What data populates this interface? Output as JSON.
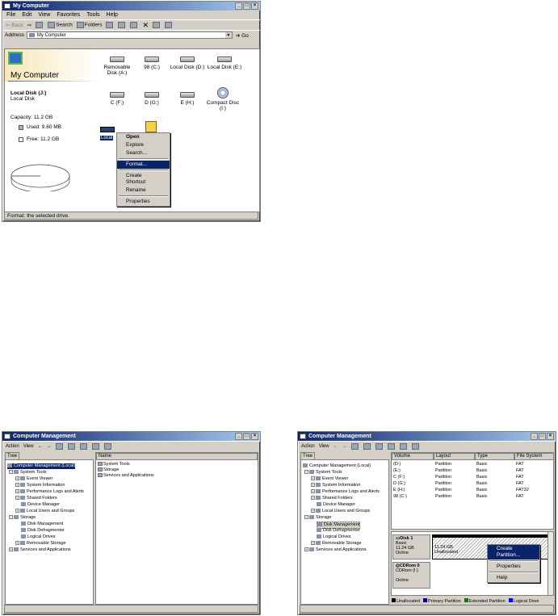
{
  "mycomputer": {
    "title": "My Computer",
    "menu": [
      "File",
      "Edit",
      "View",
      "Favorites",
      "Tools",
      "Help"
    ],
    "toolbar": {
      "back": "Back",
      "search": "Search",
      "folders": "Folders"
    },
    "address": {
      "label": "Address",
      "value": "My Computer",
      "go": "Go"
    },
    "heading": "My Computer",
    "selected": {
      "name": "Local Disk (J:)",
      "type": "Local Disk",
      "capacity": "Capacity: 11.2 GB",
      "used": "Used: 9.60 MB",
      "free": "Free: 11.2 GB"
    },
    "drives": [
      {
        "label": "Removable Disk (A:)"
      },
      {
        "label": "98 (C:)"
      },
      {
        "label": "Local Disk (D:)"
      },
      {
        "label": "Local Disk (E:)"
      },
      {
        "label": "C (F:)"
      },
      {
        "label": "D (G:)"
      },
      {
        "label": "E (H:)"
      },
      {
        "label": "Compact Disc (I:)"
      }
    ],
    "selected_drive_label": "Local",
    "context_menu": [
      "Open",
      "Explore",
      "Search...",
      "Format...",
      "Create Shortcut",
      "Rename",
      "Properties"
    ],
    "status": "Format: the selected drive.",
    "used_fraction": 0.001
  },
  "cm_left": {
    "title": "Computer Management",
    "toolbar": {
      "action": "Action",
      "view": "View"
    },
    "tree_tab": "Tree",
    "tree": [
      "Computer Management (Local)",
      "System Tools",
      "Event Viewer",
      "System Information",
      "Performance Logs and Alerts",
      "Shared Folders",
      "Device Manager",
      "Local Users and Groups",
      "Storage",
      "Disk Management",
      "Disk Defragmenter",
      "Logical Drives",
      "Removable Storage",
      "Services and Applications"
    ],
    "name_header": "Name",
    "items": [
      "System Tools",
      "Storage",
      "Services and Applications"
    ]
  },
  "cm_right": {
    "title": "Computer Management",
    "toolbar": {
      "action": "Action",
      "view": "View"
    },
    "tree_tab": "Tree",
    "tree": [
      "Computer Management (Local)",
      "System Tools",
      "Event Viewer",
      "System Information",
      "Performance Logs and Alerts",
      "Shared Folders",
      "Device Manager",
      "Local Users and Groups",
      "Storage",
      "Disk Management",
      "Disk Defragmenter",
      "Logical Drives",
      "Removable Storage",
      "Services and Applications"
    ],
    "columns": [
      "Volume",
      "Layout",
      "Type",
      "File System"
    ],
    "rows": [
      [
        "(D:)",
        "Partition",
        "Basic",
        "FAT"
      ],
      [
        "(E:)",
        "Partition",
        "Basic",
        "FAT"
      ],
      [
        "C (F:)",
        "Partition",
        "Basic",
        "FAT"
      ],
      [
        "D (G:)",
        "Partition",
        "Basic",
        "FAT"
      ],
      [
        "E (H:)",
        "Partition",
        "Basic",
        "FAT32"
      ],
      [
        "98 (C:)",
        "Partition",
        "Basic",
        "FAT"
      ]
    ],
    "disk1": {
      "name": "Disk 1",
      "type": "Basic",
      "size": "11.24 GB",
      "state": "Online",
      "part_size": "11.24 GB",
      "part_state": "Unallocated"
    },
    "cdrom": {
      "name": "CDRom 0",
      "sub": "CDRom (I:)",
      "state": "Online"
    },
    "context_menu": [
      "Create Partition...",
      "Properties",
      "Help"
    ],
    "legend": [
      {
        "label": "Unallocated",
        "color": "#000000"
      },
      {
        "label": "Primary Partition",
        "color": "#000080"
      },
      {
        "label": "Extended Partition",
        "color": "#008000"
      },
      {
        "label": "Logical Drive",
        "color": "#0000ff"
      }
    ]
  }
}
